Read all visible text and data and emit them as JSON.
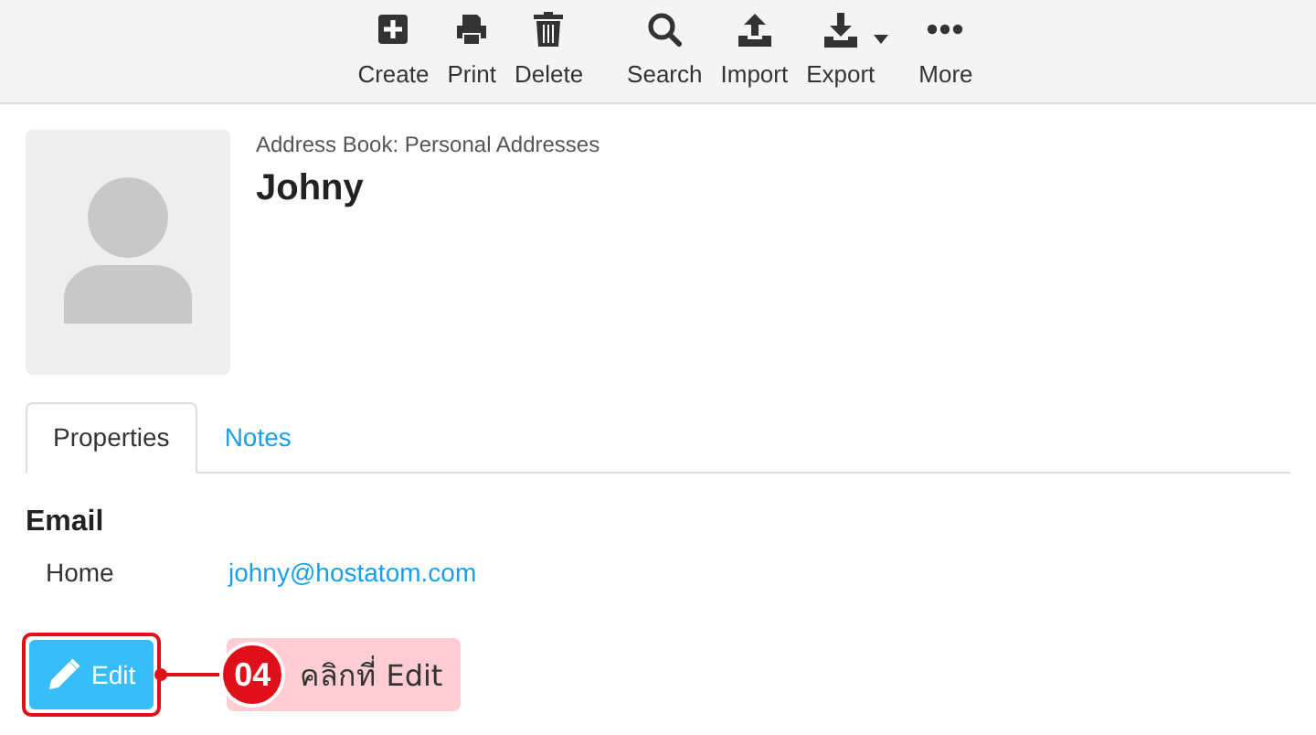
{
  "toolbar": [
    {
      "kind": "create",
      "label": "Create"
    },
    {
      "kind": "print",
      "label": "Print"
    },
    {
      "kind": "delete",
      "label": "Delete"
    },
    {
      "kind": "search",
      "label": "Search"
    },
    {
      "kind": "import",
      "label": "Import"
    },
    {
      "kind": "export",
      "label": "Export"
    },
    {
      "kind": "more",
      "label": "More"
    }
  ],
  "contact": {
    "address_book": "Address Book: Personal Addresses",
    "name": "Johny"
  },
  "tabs": [
    {
      "label": "Properties",
      "selected": true
    },
    {
      "label": "Notes",
      "selected": false
    }
  ],
  "email": {
    "heading": "Email",
    "rows": [
      {
        "label": "Home",
        "value": "johny@hostatom.com"
      }
    ]
  },
  "edit_button": "Edit",
  "callout": {
    "step": "04",
    "text": "คลิกที่ Edit"
  }
}
